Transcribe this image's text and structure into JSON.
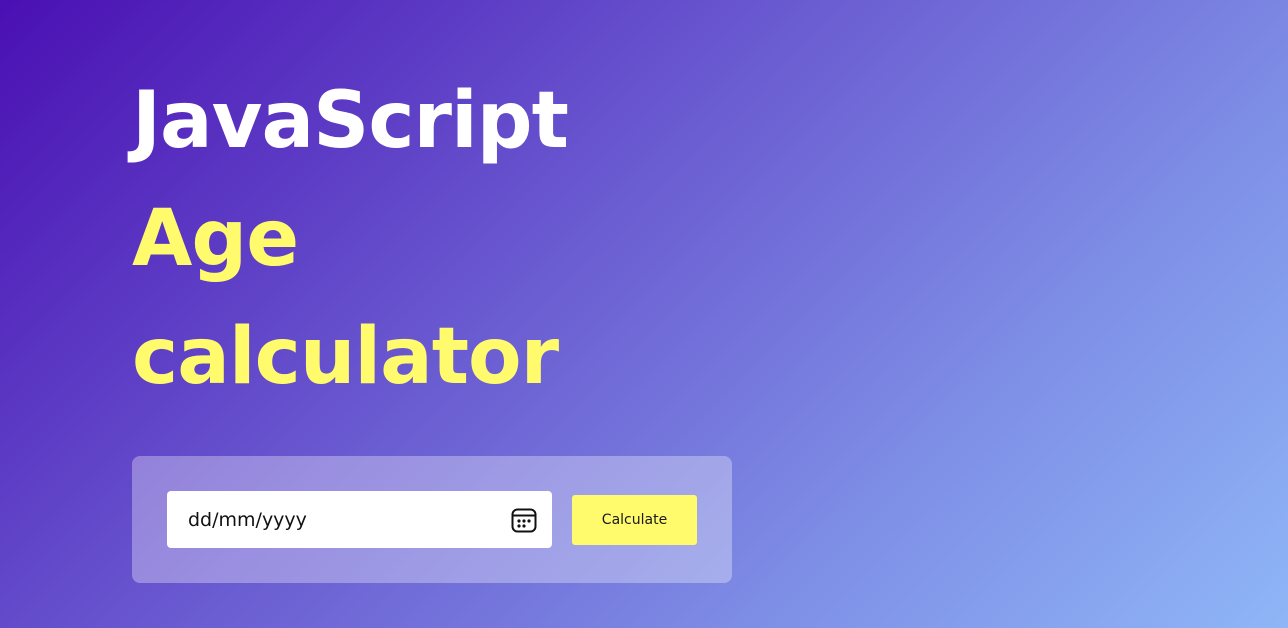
{
  "heading": {
    "line1": "JavaScript",
    "line2": "Age",
    "line3": "calculator"
  },
  "form": {
    "date_value": "dd/mm/yyyy",
    "calendar_icon": "calendar-icon",
    "button_label": "Calculate"
  },
  "colors": {
    "accent": "#fffb6d",
    "title_white": "#ffffff",
    "gradient_start": "#4a0fb3",
    "gradient_end": "#8fb6f7"
  }
}
